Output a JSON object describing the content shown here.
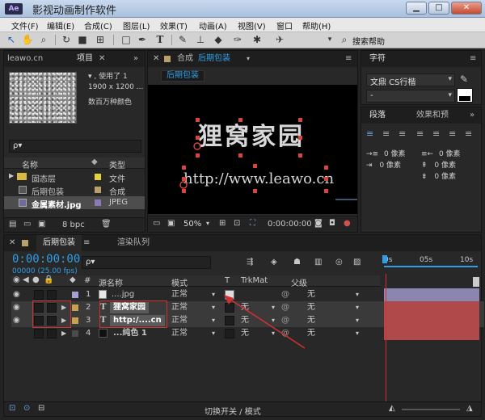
{
  "window": {
    "title": "影视动画制作软件",
    "logo": "Ae"
  },
  "menu": [
    "文件(F)",
    "编辑(E)",
    "合成(C)",
    "图层(L)",
    "效果(T)",
    "动画(A)",
    "视图(V)",
    "窗口",
    "帮助(H)"
  ],
  "toolbar": {
    "search_label": "搜索帮助",
    "tool_icons": [
      "selection-tool-icon",
      "hand-tool-icon",
      "zoom-tool-icon",
      "rotate-tool-icon",
      "camera-tool-icon",
      "pan-behind-tool-icon",
      "rectangle-tool-icon",
      "pen-tool-icon",
      "type-tool-icon",
      "brush-tool-icon",
      "clone-stamp-tool-icon",
      "eraser-tool-icon",
      "roto-brush-tool-icon",
      "puppet-pin-tool-icon"
    ]
  },
  "project": {
    "top_tab": "leawo.cn",
    "tab": "项目",
    "preview_info": [
      "▾ , 使用了 1",
      "1900 x 1200 ...",
      "数百万种颜色"
    ],
    "search_placeholder": "ρ▾",
    "col_name": "名称",
    "col_type": "类型",
    "items": [
      {
        "name": "固态层",
        "type": "文件",
        "icon": "folder-icon",
        "label_color": "#e6d23a"
      },
      {
        "name": "后期包装",
        "type": "合成",
        "icon": "composition-icon",
        "label_color": "#b9a06a"
      },
      {
        "name": "金属素材.jpg",
        "type": "JPEG",
        "icon": "image-file-icon",
        "label_color": "#8a7ab8"
      }
    ],
    "bpc": "8 bpc"
  },
  "composition": {
    "prefix": "合成",
    "name": "后期包装",
    "tab_label": "后期包装",
    "canvas_title": "狸窝家园",
    "canvas_url": "http://www.leawo.cn",
    "zoom": "50%",
    "timecode": "0:00:00:00"
  },
  "character": {
    "tab": "字符",
    "font": "文鼎 CS行楷",
    "style": "-"
  },
  "paragraph": {
    "tab_paragraph": "段落",
    "tab_effects": "效果和预",
    "indent_values": [
      "0 像素",
      "0 像素",
      "0 像素",
      "0 像素",
      "0 像素"
    ]
  },
  "timeline": {
    "tab": "后期包装",
    "render_tab": "渲染队列",
    "timecode": "0:00:00:00",
    "fps": "00000 (25.00 fps)",
    "search_placeholder": "ρ▾",
    "col_source": "源名称",
    "col_mode": "模式",
    "col_t": "T",
    "col_trkmat": "TrkMat",
    "col_parent": "父级",
    "ruler": [
      "0s",
      "05s",
      "10s"
    ],
    "layers": [
      {
        "num": "1",
        "name": "....jpg",
        "mode": "正常",
        "trkmat": "",
        "parent": "无",
        "color": "#a79fd4",
        "icon": "image-layer-icon"
      },
      {
        "num": "2",
        "name": "狸窝家园",
        "mode": "正常",
        "trkmat": "无",
        "parent": "无",
        "color": "#c9a24e",
        "icon": "text-layer-icon"
      },
      {
        "num": "3",
        "name": "http:/....cn",
        "mode": "正常",
        "trkmat": "无",
        "parent": "无",
        "color": "#c9a24e",
        "icon": "text-layer-icon"
      },
      {
        "num": "4",
        "name": "...纯色 1",
        "mode": "正常",
        "trkmat": "无",
        "parent": "无",
        "color": "#4c4c4c",
        "icon": "solid-layer-icon"
      }
    ],
    "footer_label": "切换开关 / 模式"
  }
}
